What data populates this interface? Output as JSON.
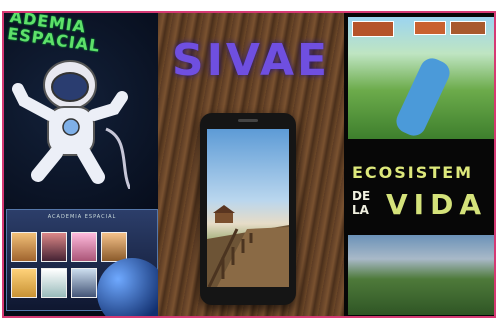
{
  "left": {
    "title": "ADEMIA ESPACIAL",
    "screenshot_title": "ACADEMIA ESPACIAL"
  },
  "center": {
    "title": "SIVAE"
  },
  "right": {
    "title_line1": "ECOSISTEM",
    "title_de": "DE",
    "title_la": "LA",
    "title_vida": "VIDA"
  },
  "colors": {
    "frame": "#d63a74",
    "left_title": "#5fe06a",
    "center_title": "#6f4fe0",
    "right_title": "#d4e27a"
  }
}
